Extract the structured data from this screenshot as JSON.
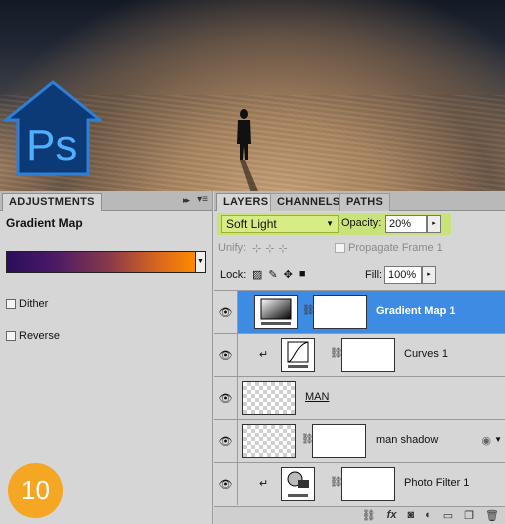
{
  "photo": {
    "logo_text": "Ps"
  },
  "adjustments": {
    "tab_label": "ADJUSTMENTS",
    "collapse_glyph": "▸▸",
    "menu_glyph": "▾≡",
    "title": "Gradient Map",
    "gradient_colors": [
      "#2b0e5c",
      "#ff8a00"
    ],
    "dropdown_glyph": "▼",
    "options": [
      {
        "label": "Dither",
        "checked": false
      },
      {
        "label": "Reverse",
        "checked": false
      }
    ]
  },
  "badge": {
    "text": "10",
    "color": "#f5a623"
  },
  "layers_panel": {
    "tabs": [
      "LAYERS",
      "CHANNELS",
      "PATHS"
    ],
    "blend_mode": "Soft Light",
    "opacity_label": "Opacity:",
    "opacity_value": "20%",
    "unify_label": "Unify:",
    "propagate_label": "Propagate Frame 1",
    "lock_label": "Lock:",
    "fill_label": "Fill:",
    "fill_value": "100%",
    "layers": [
      {
        "name": "Gradient Map 1",
        "selected": true,
        "clipped": false,
        "type": "adjustment"
      },
      {
        "name": "Curves 1",
        "selected": false,
        "clipped": true,
        "type": "adjustment"
      },
      {
        "name": "MAN",
        "selected": false,
        "clipped": false,
        "type": "pixel"
      },
      {
        "name": "man shadow",
        "selected": false,
        "clipped": false,
        "type": "pixel-masked"
      },
      {
        "name": "Photo Filter 1",
        "selected": false,
        "clipped": true,
        "type": "adjustment"
      }
    ],
    "bottom_icons": [
      "link-icon",
      "fx-icon",
      "mask-icon",
      "adjustment-icon",
      "group-icon",
      "new-layer-icon",
      "trash-icon"
    ],
    "highlight_color": "#c9e37a",
    "selection_color": "#3d8be3"
  }
}
